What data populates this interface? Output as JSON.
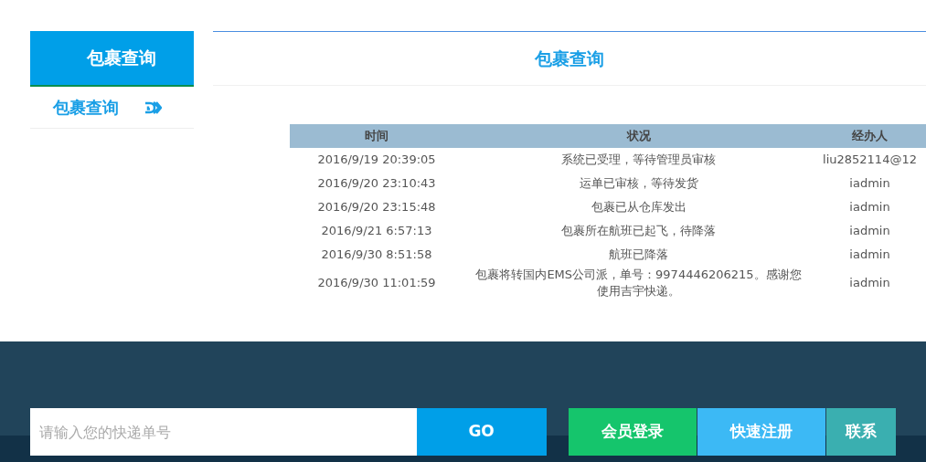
{
  "sidebar": {
    "title": "包裹查询",
    "items": [
      {
        "label": "包裹查询",
        "selected": true
      }
    ]
  },
  "main": {
    "title": "包裹查询"
  },
  "table": {
    "columns": [
      "时间",
      "状况",
      "经办人"
    ],
    "rows": [
      [
        "2016/9/19 20:39:05",
        "系统已受理，等待管理员审核",
        "liu2852114@12"
      ],
      [
        "2016/9/20 23:10:43",
        "运单已审核，等待发货",
        "iadmin"
      ],
      [
        "2016/9/20 23:15:48",
        "包裹已从仓库发出",
        "iadmin"
      ],
      [
        "2016/9/21 6:57:13",
        "包裹所在航班已起飞，待降落",
        "iadmin"
      ],
      [
        "2016/9/30 8:51:58",
        "航班已降落",
        "iadmin"
      ],
      [
        "2016/9/30 11:01:59",
        "包裹将转国内EMS公司派，单号：9974446206215。感谢您使用吉宇快递。",
        "iadmin"
      ]
    ]
  },
  "footer": {
    "search": {
      "placeholder": "请输入您的快递单号",
      "button": "GO"
    },
    "buttons": [
      {
        "label": "会员登录",
        "kind": "login"
      },
      {
        "label": "快速注册",
        "kind": "register"
      },
      {
        "label": "联系",
        "kind": "contact"
      }
    ]
  }
}
